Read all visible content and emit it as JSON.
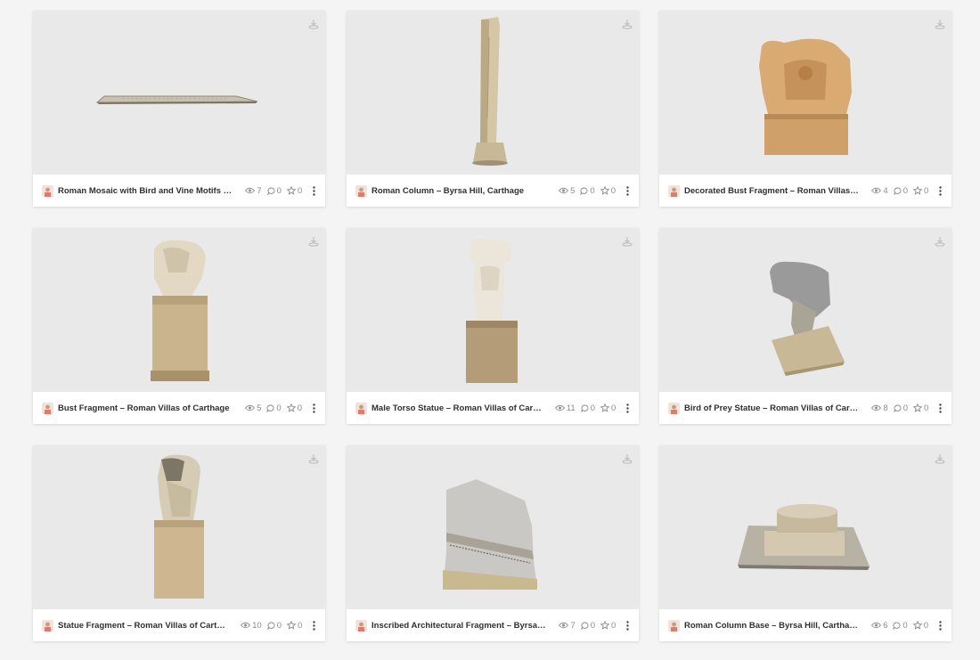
{
  "cards": [
    {
      "title": "Roman Mosaic with Bird and Vine Motifs – ...",
      "views": "7",
      "comments": "0",
      "likes": "0",
      "art": "mosaic-slab"
    },
    {
      "title": "Roman Column – Byrsa Hill, Carthage",
      "views": "5",
      "comments": "0",
      "likes": "0",
      "art": "column"
    },
    {
      "title": "Decorated Bust Fragment – Roman Villas o...",
      "views": "4",
      "comments": "0",
      "likes": "0",
      "art": "decorated-bust"
    },
    {
      "title": "Bust Fragment – Roman Villas of Carthage",
      "views": "5",
      "comments": "0",
      "likes": "0",
      "art": "bust-on-pedestal"
    },
    {
      "title": "Male Torso Statue – Roman Villas of Carth...",
      "views": "11",
      "comments": "0",
      "likes": "0",
      "art": "male-torso"
    },
    {
      "title": "Bird of Prey Statue – Roman Villas of Carth...",
      "views": "8",
      "comments": "0",
      "likes": "0",
      "art": "bird-statue"
    },
    {
      "title": "Statue Fragment – Roman Villas of Cartha...",
      "views": "10",
      "comments": "0",
      "likes": "0",
      "art": "statue-fragment"
    },
    {
      "title": "Inscribed Architectural Fragment – Byrsa H...",
      "views": "7",
      "comments": "0",
      "likes": "0",
      "art": "inscribed-block"
    },
    {
      "title": "Roman Column Base – Byrsa Hill, Carthage",
      "views": "6",
      "comments": "0",
      "likes": "0",
      "art": "column-base"
    }
  ],
  "colors": {
    "thumb_bg": "#e9e9e9",
    "stone_light": "#d8c9a8",
    "stone_dark": "#a8967a",
    "icon_gray": "#8a8a8a"
  }
}
